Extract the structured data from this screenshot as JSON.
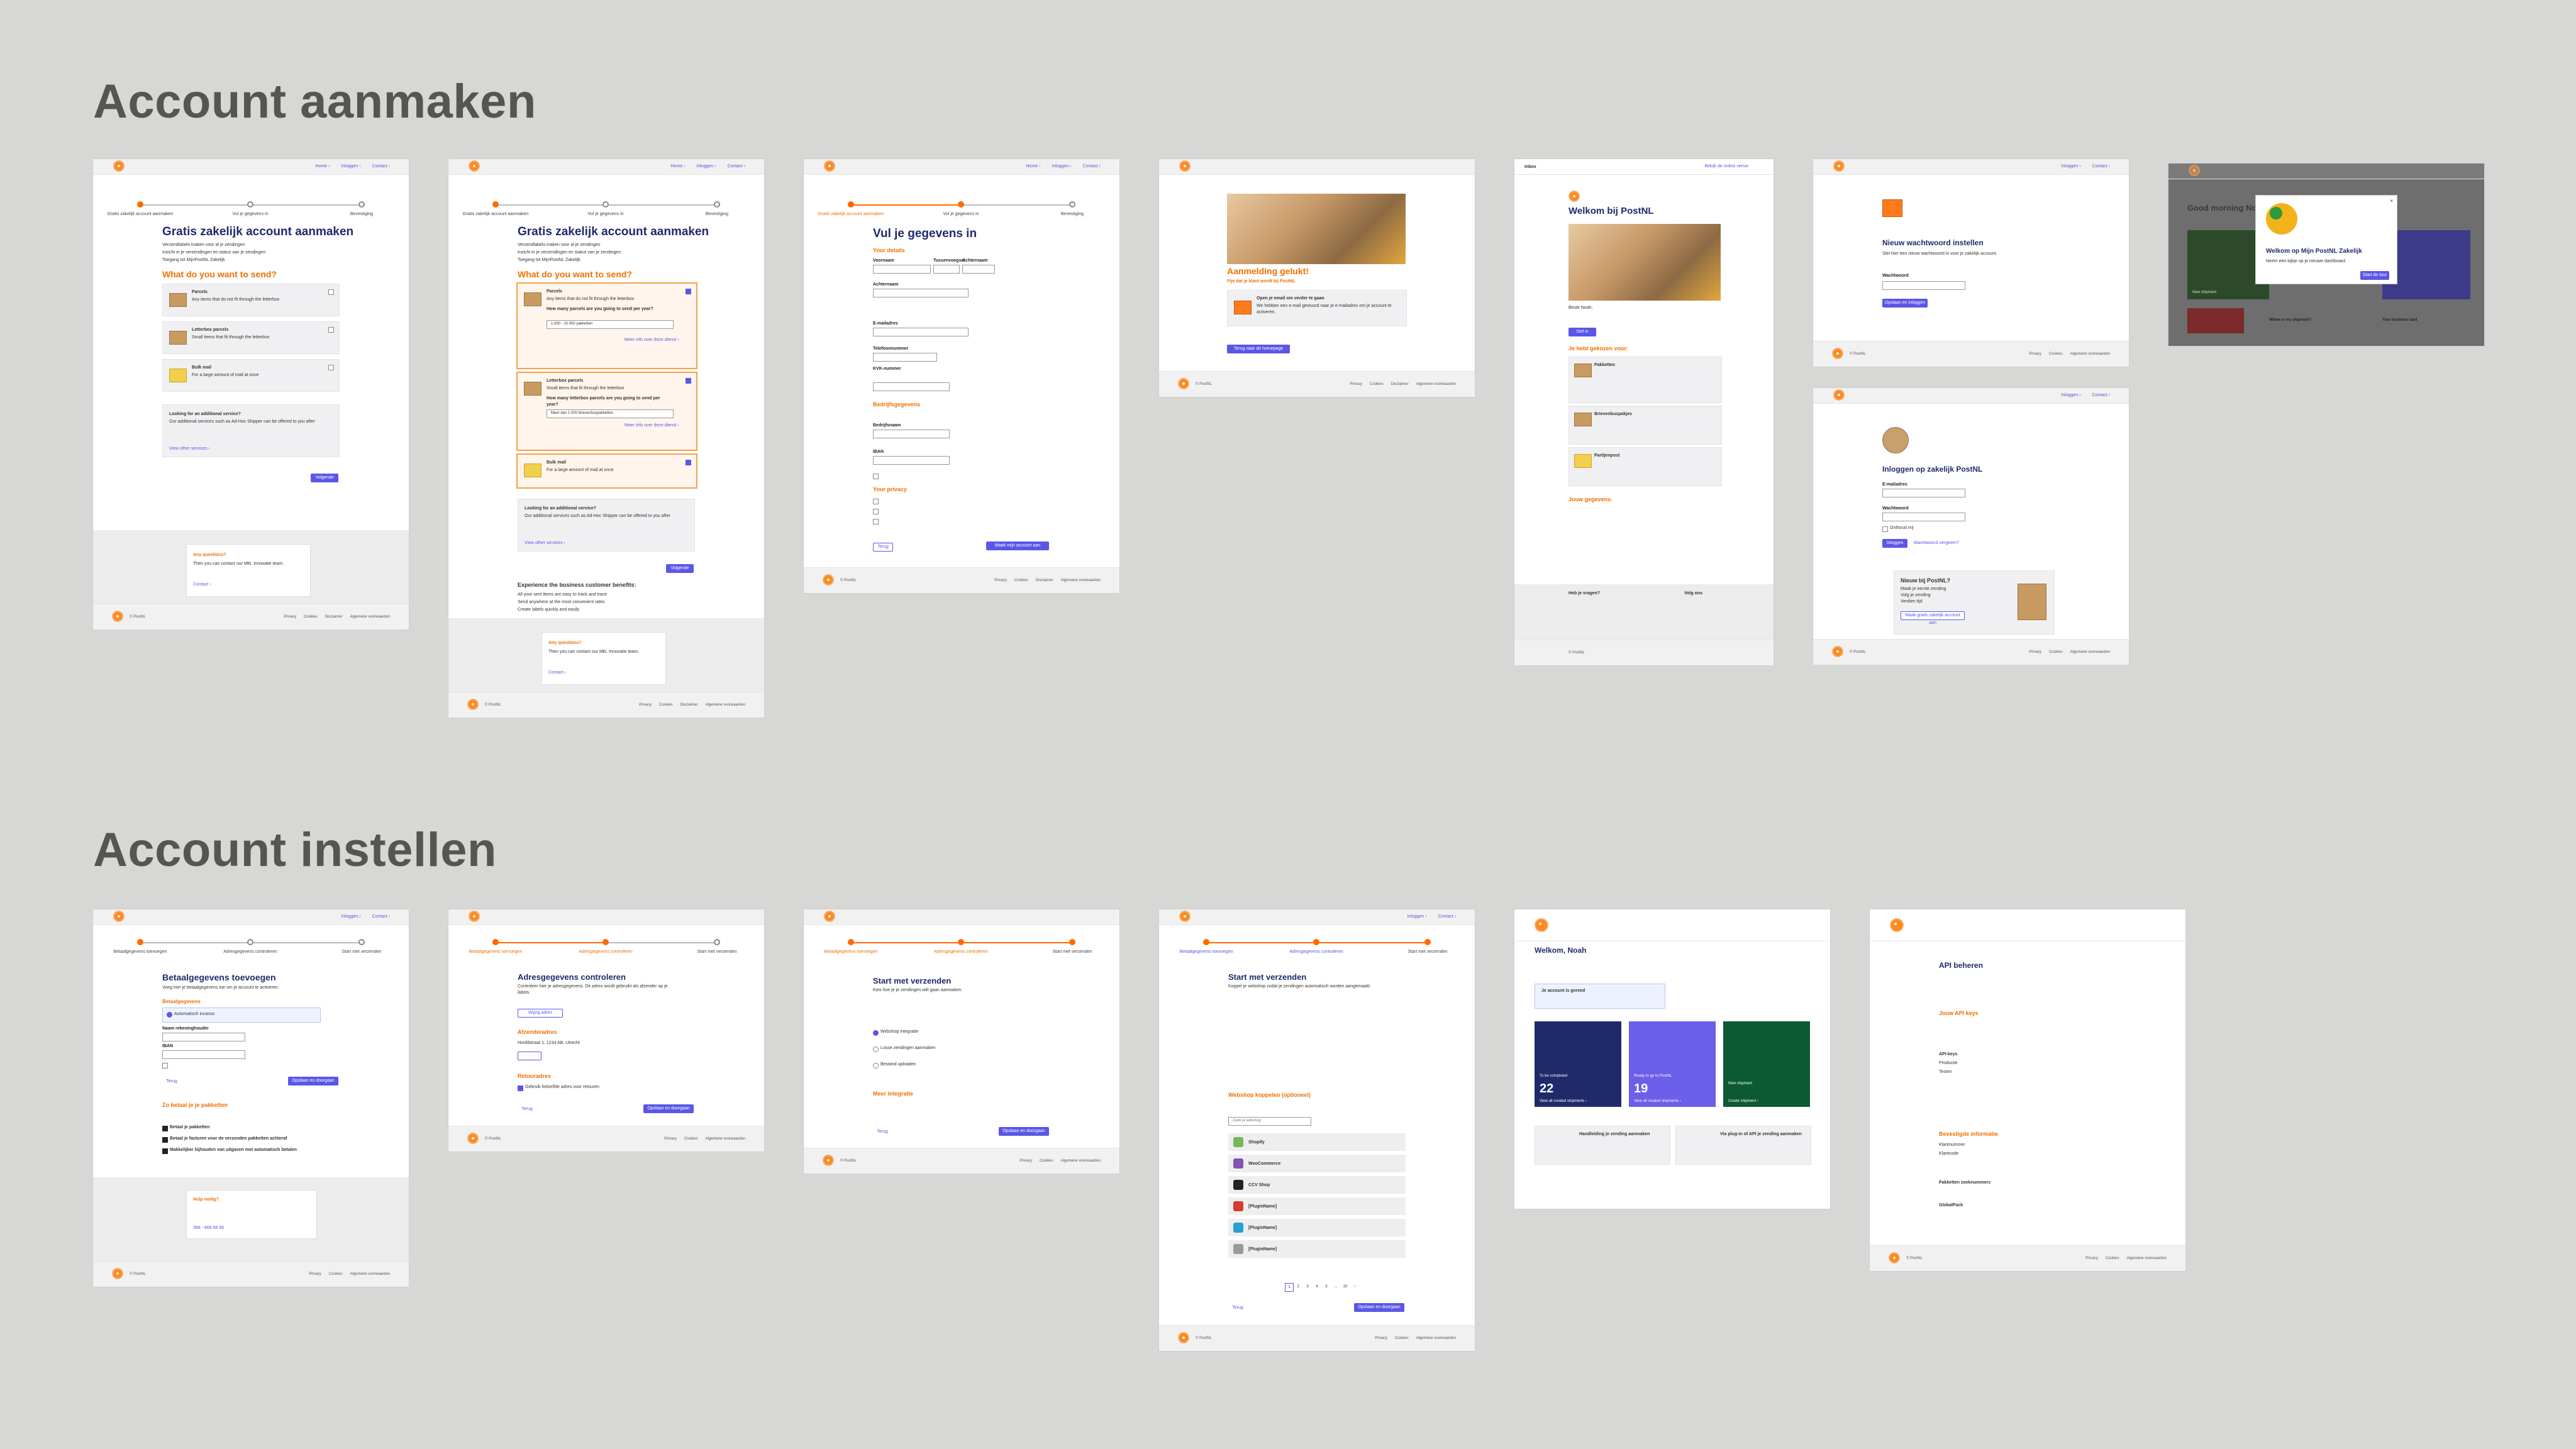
{
  "titles": {
    "create": "Account aanmaken",
    "setup": "Account instellen"
  },
  "common": {
    "nav_home": "Home ›",
    "nav_login": "Inloggen ›",
    "nav_contact": "Contact ›",
    "footer_brand": "© PostNL",
    "footer_privacy": "Privacy",
    "footer_cookies": "Cookies",
    "footer_disclaimer": "Disclaimer",
    "footer_terms": "Algemene voorwaarden",
    "btn_next": "Volgende",
    "btn_back": "Terug"
  },
  "s1": {
    "step1": "Gratis zakelijk account aanmaken",
    "step2": "Vul je gegevens in",
    "step3": "Bevestiging",
    "title": "Gratis zakelijk account aanmaken",
    "bullet1": "Verzendlabels maken voor al je zendingen",
    "bullet2": "Inzicht in je verzendingen en status van je zendingen",
    "bullet3": "Toegang tot MijnPostNL Zakelijk",
    "question": "What do you want to send?",
    "opt1": "Parcels",
    "opt1_desc": "Any items that do not fit through the letterbox",
    "opt2": "Letterbox parcels",
    "opt2_desc": "Small items that fit through the letterbox",
    "opt3": "Bulk mail",
    "opt3_desc": "For a large amount of mail at once",
    "extra_title": "Looking for an additional service?",
    "extra_desc": "Our additional services such as Ad-Hoc Shipper can be offered to you after",
    "extra_link": "View other services ›",
    "any_q": "Any questions?",
    "any_q_desc": "Then you can contact our Mkt. Innovatie team.",
    "contact": "Contact ›"
  },
  "s2": {
    "opt1_q": "How many parcels are you going to send per year?",
    "opt1_val": "1.000 - 10.000 pakketten",
    "opt2_q": "How many letterbox parcels are you going to send per year?",
    "opt2_val": "Meer dan 1.000 brievenbuspakketten",
    "more_link": "Meer info over deze dienst ›",
    "benefits_title": "Experience the business customer benefits:",
    "benefit1": "All your sent items are easy to track and trace",
    "benefit2": "Send anywhere at the most convenient rates",
    "benefit3": "Create labels quickly and easily"
  },
  "s3": {
    "title": "Vul je gegevens in",
    "your_details": "Your details",
    "firstname": "Voornaam",
    "infix": "Tussenvoegsel",
    "lastname": "Achternaam",
    "email": "E-mailadres",
    "phone": "Telefoonnummer",
    "company_details": "Bedrijfsgegevens",
    "kvk": "KVK-nummer",
    "company": "Bedrijfsnaam",
    "bank": "Bank details",
    "iban": "IBAN",
    "privacy": "Your privacy",
    "submit": "Maak mijn account aan"
  },
  "s4": {
    "title": "Aanmelding gelukt!",
    "subtitle": "Fijn dat je klant wordt bij PostNL",
    "box_title": "Open je email om verder te gaan",
    "box_desc": "We hebben een e-mail gestuurd naar je e-mailadres om je account te activeren.",
    "btn": "Terug naar de homepage"
  },
  "s5": {
    "mailbar": "Inbox",
    "view_online": "Bekijk de online versie",
    "title": "Welkom bij PostNL",
    "greeting": "Beste Noah,",
    "btn": "Stel in",
    "section1": "Je hebt gekozen voor:",
    "item1": "Pakketten",
    "item2": "Brievenbuspakjes",
    "item3": "Partijenpost",
    "section2": "Jouw gegevens:",
    "help": "Heb je vragen?",
    "follow": "Volg ons"
  },
  "s6": {
    "title": "Nieuw wachtwoord instellen",
    "desc": "Stel hier een nieuw wachtwoord in voor je zakelijk account.",
    "field": "Wachtwoord",
    "btn": "Opslaan en inloggen"
  },
  "s7": {
    "title": "Inloggen op zakelijk PostNL",
    "email": "E-mailadres",
    "password": "Wachtwoord",
    "remember": "Onthoud mij",
    "btn": "Inloggen",
    "forgot": "Wachtwoord vergeten?",
    "new_title": "Nieuw bij PostNL?",
    "new1": "Maak je eerste zending",
    "new2": "Volg je zending",
    "new3": "Verdien tijd",
    "new_btn": "Maak gratis zakelijk account aan"
  },
  "s8": {
    "greeting": "Good morning Noah",
    "modal_title": "Welkom op Mijn PostNL Zakelijk",
    "modal_desc": "Neem een kijkje op je nieuwe dashboard",
    "modal_btn": "Start de tour",
    "tile1": "New shipment",
    "tile2": "Where is my shipment?",
    "tile3": "Your business card"
  },
  "b1": {
    "step1": "Betaalgegevens toevoegen",
    "step2": "Adresgegevens controleren",
    "step3": "Start met verzenden",
    "title": "Betaalgegevens toevoegen",
    "desc": "Voeg hier je betaalgegevens toe om je account te activeren.",
    "method": "Betaalgegevens",
    "sepa": "Automatisch incasso",
    "name": "Naam rekeninghouder",
    "iban": "IBAN",
    "how": "Zo betaal je je pakketten",
    "pay1": "Betaal je pakketten",
    "pay2": "Betaal je facturen voor de verzonden pakketten achteraf",
    "pay3": "Makkelijker bijhouden van uitgaven met automatisch betalen",
    "help_title": "Hulp nodig?",
    "phone": "088 - 868 68 68",
    "save": "Opslaan en doorgaan"
  },
  "b2": {
    "title": "Adresgegevens controleren",
    "desc": "Controleer hier je adresgegevens. Dit adres wordt gebruikt als afzender op je labels.",
    "change": "Wijzig adres",
    "billing": "Afzenderadres",
    "billing_addr": "Hoofdstraat 1, 1234 AB, Utrecht",
    "returns": "Retouradres",
    "returns_check": "Gebruik hetzelfde adres voor retouren"
  },
  "b3": {
    "title": "Start met verzenden",
    "desc": "Kies hoe je je zendingen wilt gaan aanmaken.",
    "opt1": "Webshop integratie",
    "opt2": "Losse zendingen aanmaken",
    "opt3": "Bestand uploaden",
    "more": "Meer integratie",
    "btn": "Opslaan en doorgaan"
  },
  "b4": {
    "title": "Start met verzenden",
    "desc": "Koppel je webshop zodat je zendingen automatisch worden aangemaakt.",
    "webshop": "Webshop koppelen (optioneel)",
    "search": "Zoek je webshop",
    "shops": [
      "Shopify",
      "WooCommerce",
      "CCV Shop",
      "[PluginName]",
      "[PluginName]",
      "[PluginName]"
    ],
    "pages": [
      "1",
      "2",
      "3",
      "4",
      "5",
      "...",
      "10",
      "›"
    ]
  },
  "b5": {
    "title": "Welkom, Noah",
    "notice": "Je account is gereed",
    "tile1_label": "To be completed",
    "tile1_num": "22",
    "tile2_label": "Ready to go to PostNL",
    "tile2_num": "19",
    "tile3_label": "New shipment",
    "card1": "Handleiding je zending aanmaken",
    "card2": "Via plug-in of API je zending aanmaken",
    "link1": "View all created shipments ›",
    "link2": "View all created shipments ›",
    "link3": "Create shipment ›"
  },
  "b6": {
    "title": "API beheren",
    "keys": "Jouw API keys",
    "api_keys": "API-keys",
    "prod": "Productie",
    "test": "Testen",
    "customer_info": "Bevestigde informatie",
    "customer_code": "Klantnummer",
    "customer_number": "Klantcode",
    "labels": "Pakketten zoeknummers",
    "globalpack": "GlobalPack"
  },
  "colors": {
    "accent": "#5b57e6",
    "orange": "#ef6f00",
    "navy": "#1f2a6b"
  }
}
